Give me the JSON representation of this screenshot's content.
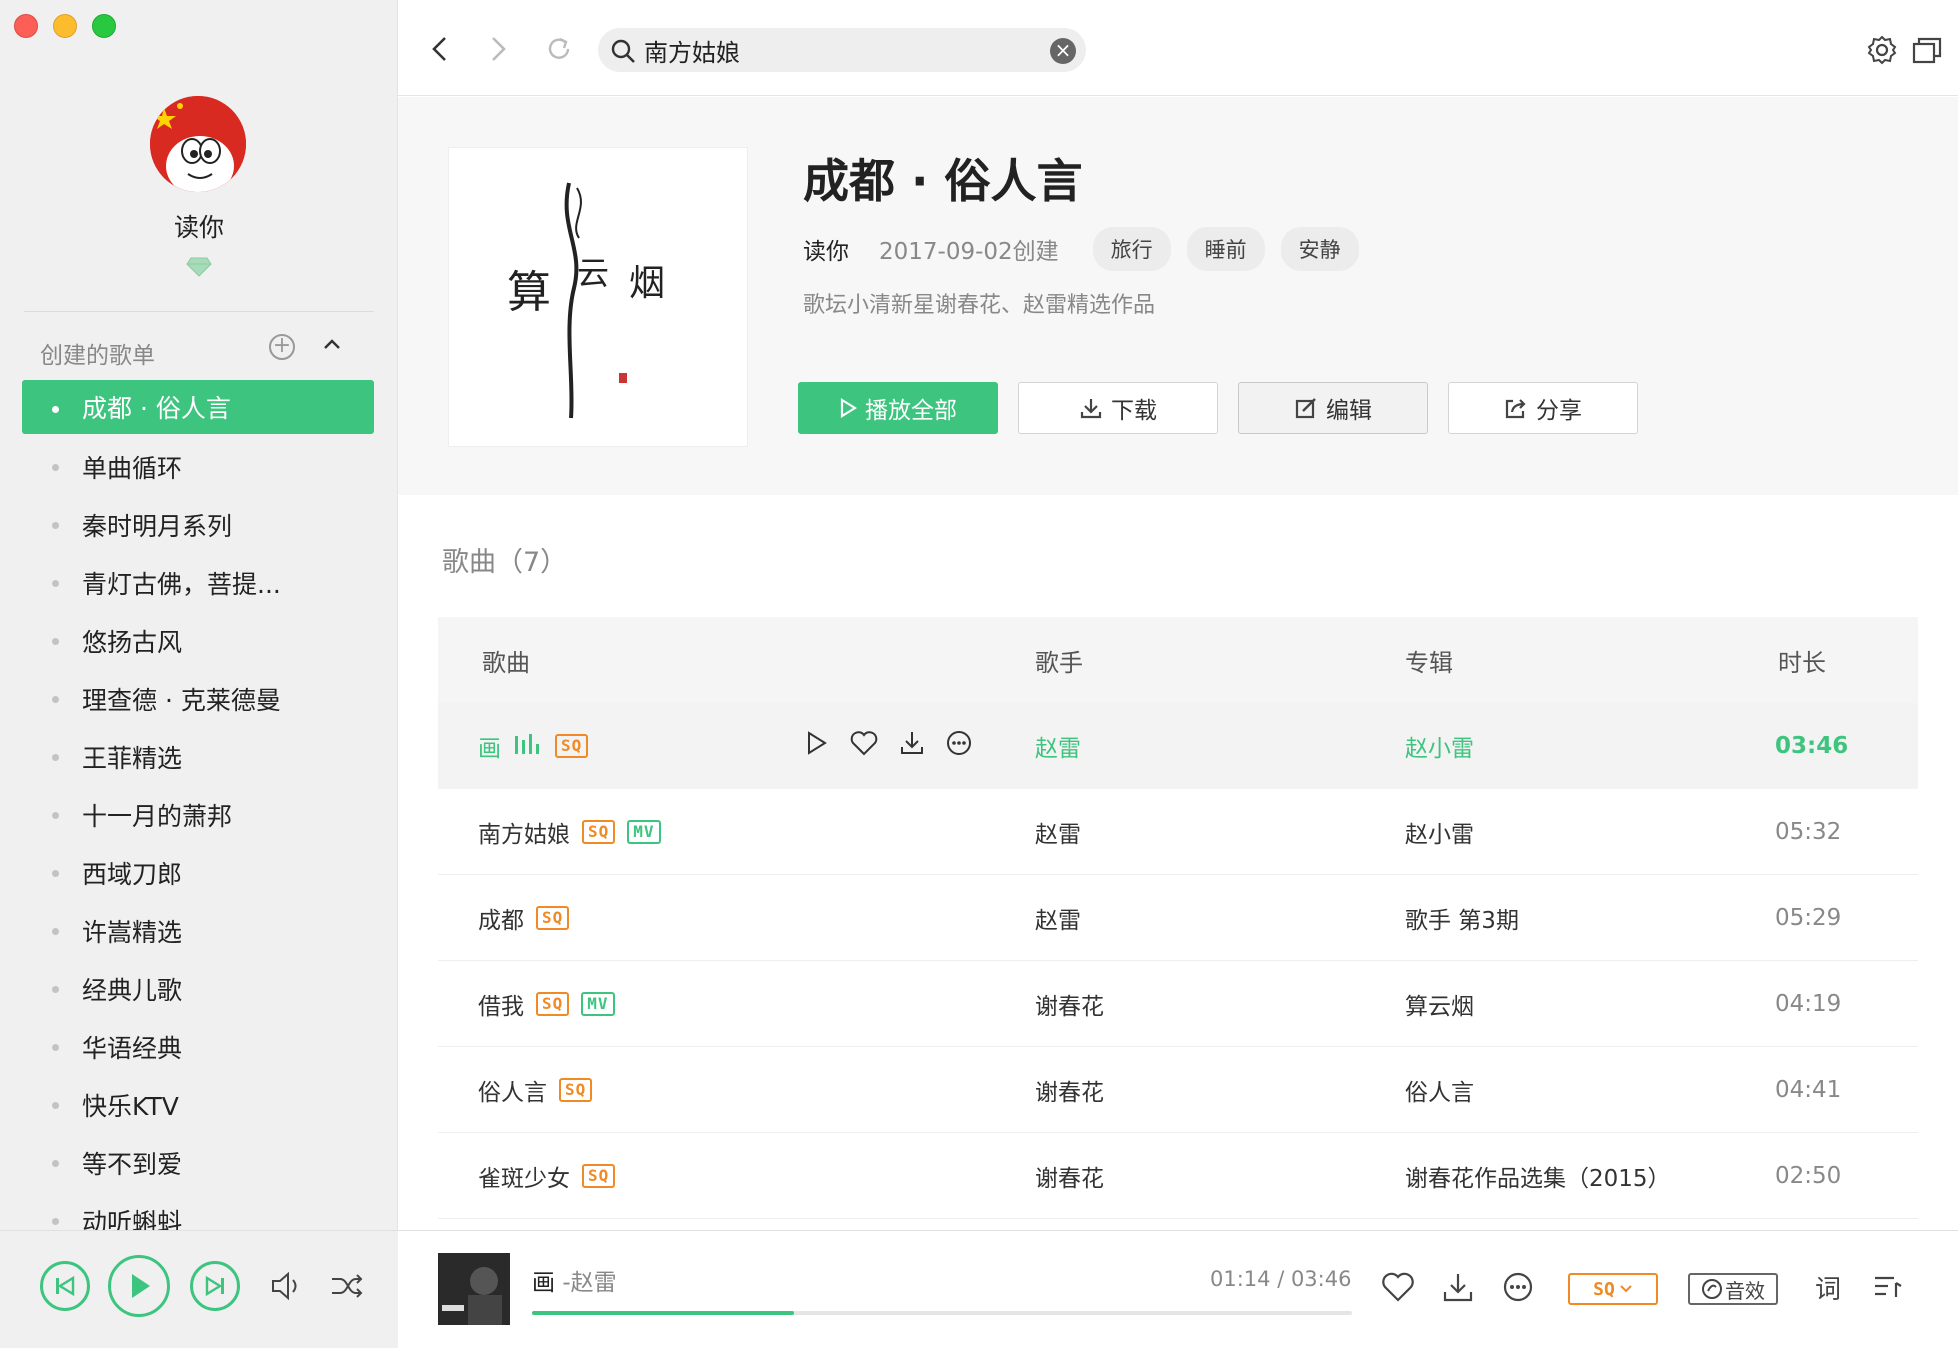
{
  "search": {
    "value": "南方姑娘",
    "placeholder": ""
  },
  "user": {
    "name": "读你"
  },
  "sidebar": {
    "section_title": "创建的歌单",
    "items": [
      {
        "label": "成都 · 俗人言"
      },
      {
        "label": "单曲循环"
      },
      {
        "label": "秦时明月系列"
      },
      {
        "label": "青灯古佛，菩提..."
      },
      {
        "label": "悠扬古风"
      },
      {
        "label": "理查德 · 克莱德曼"
      },
      {
        "label": "王菲精选"
      },
      {
        "label": "十一月的萧邦"
      },
      {
        "label": "西域刀郎"
      },
      {
        "label": "许嵩精选"
      },
      {
        "label": "经典儿歌"
      },
      {
        "label": "华语经典"
      },
      {
        "label": "快乐KTV"
      },
      {
        "label": "等不到爱"
      },
      {
        "label": "动听蝌蚪"
      }
    ]
  },
  "playlist": {
    "title": "成都 · 俗人言",
    "creator": "读你",
    "created": "2017-09-02创建",
    "tags": [
      "旅行",
      "睡前",
      "安静"
    ],
    "description": "歌坛小清新星谢春花、赵雷精选作品",
    "buttons": {
      "play_all": "播放全部",
      "download": "下载",
      "edit": "编辑",
      "share": "分享"
    },
    "cover_text": [
      "算",
      "云",
      "烟"
    ]
  },
  "songs": {
    "count_label": "歌曲（7）",
    "headers": {
      "song": "歌曲",
      "artist": "歌手",
      "album": "专辑",
      "duration": "时长"
    },
    "rows": [
      {
        "title": "画",
        "artist": "赵雷",
        "album": "赵小雷",
        "duration": "03:46"
      },
      {
        "title": "南方姑娘",
        "artist": "赵雷",
        "album": "赵小雷",
        "duration": "05:32"
      },
      {
        "title": "成都",
        "artist": "赵雷",
        "album": "歌手 第3期",
        "duration": "05:29"
      },
      {
        "title": "借我",
        "artist": "谢春花",
        "album": "算云烟",
        "duration": "04:19"
      },
      {
        "title": "俗人言",
        "artist": "谢春花",
        "album": "俗人言",
        "duration": "04:41"
      },
      {
        "title": "雀斑少女",
        "artist": "谢春花",
        "album": "谢春花作品选集（2015）",
        "duration": "02:50"
      }
    ],
    "badges": {
      "sq": "SQ",
      "mv": "MV"
    }
  },
  "player": {
    "title": "画",
    "artist": "-赵雷",
    "time": "01:14 / 03:46",
    "progress": 0.32,
    "quality": "SQ",
    "effect_label": "音效",
    "lyrics_label": "词"
  },
  "colors": {
    "accent": "#3dc47e",
    "sq": "#f08a24"
  }
}
